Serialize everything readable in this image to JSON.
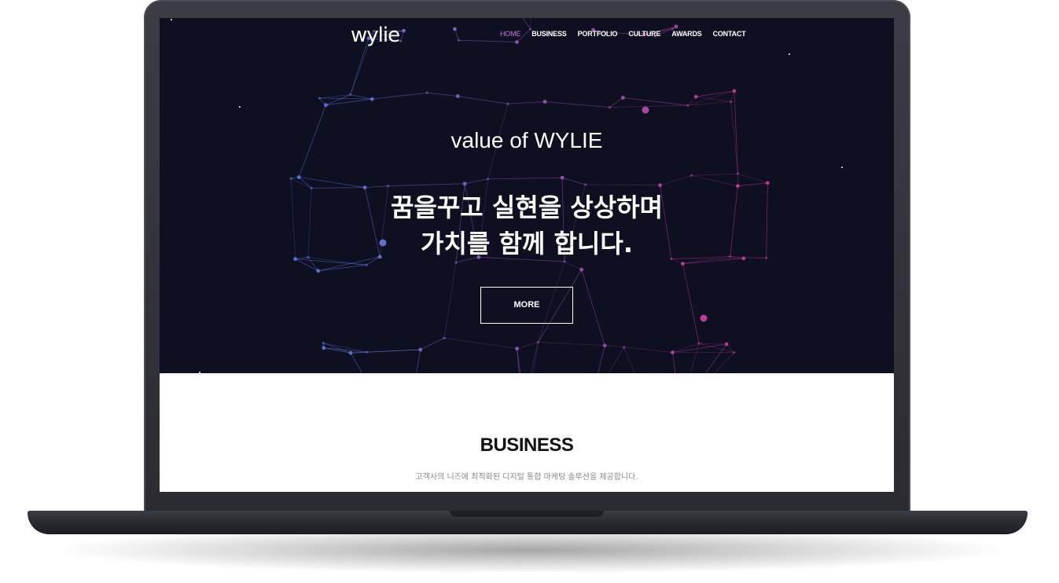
{
  "logo": "wylie",
  "nav": {
    "items": [
      "HOME",
      "BUSINESS",
      "PORTFOLIO",
      "CULTURE",
      "AWARDS",
      "CONTACT"
    ],
    "active": "HOME"
  },
  "hero": {
    "subtitle": "value of WYLIE",
    "title_line1": "꿈을꾸고 실현을 상상하며",
    "title_line2": "가치를 함께 합니다.",
    "button": "MORE"
  },
  "business": {
    "title": "BUSINESS",
    "description": "고객사의 니즈에 최적화된 디지털 통합 마케팅 솔루션을 제공합니다."
  },
  "colors": {
    "hero_bg": "#0f0f22",
    "nav_active": "#c77ad8",
    "node_blue": "#4a7fe0",
    "node_magenta": "#d0308a"
  }
}
